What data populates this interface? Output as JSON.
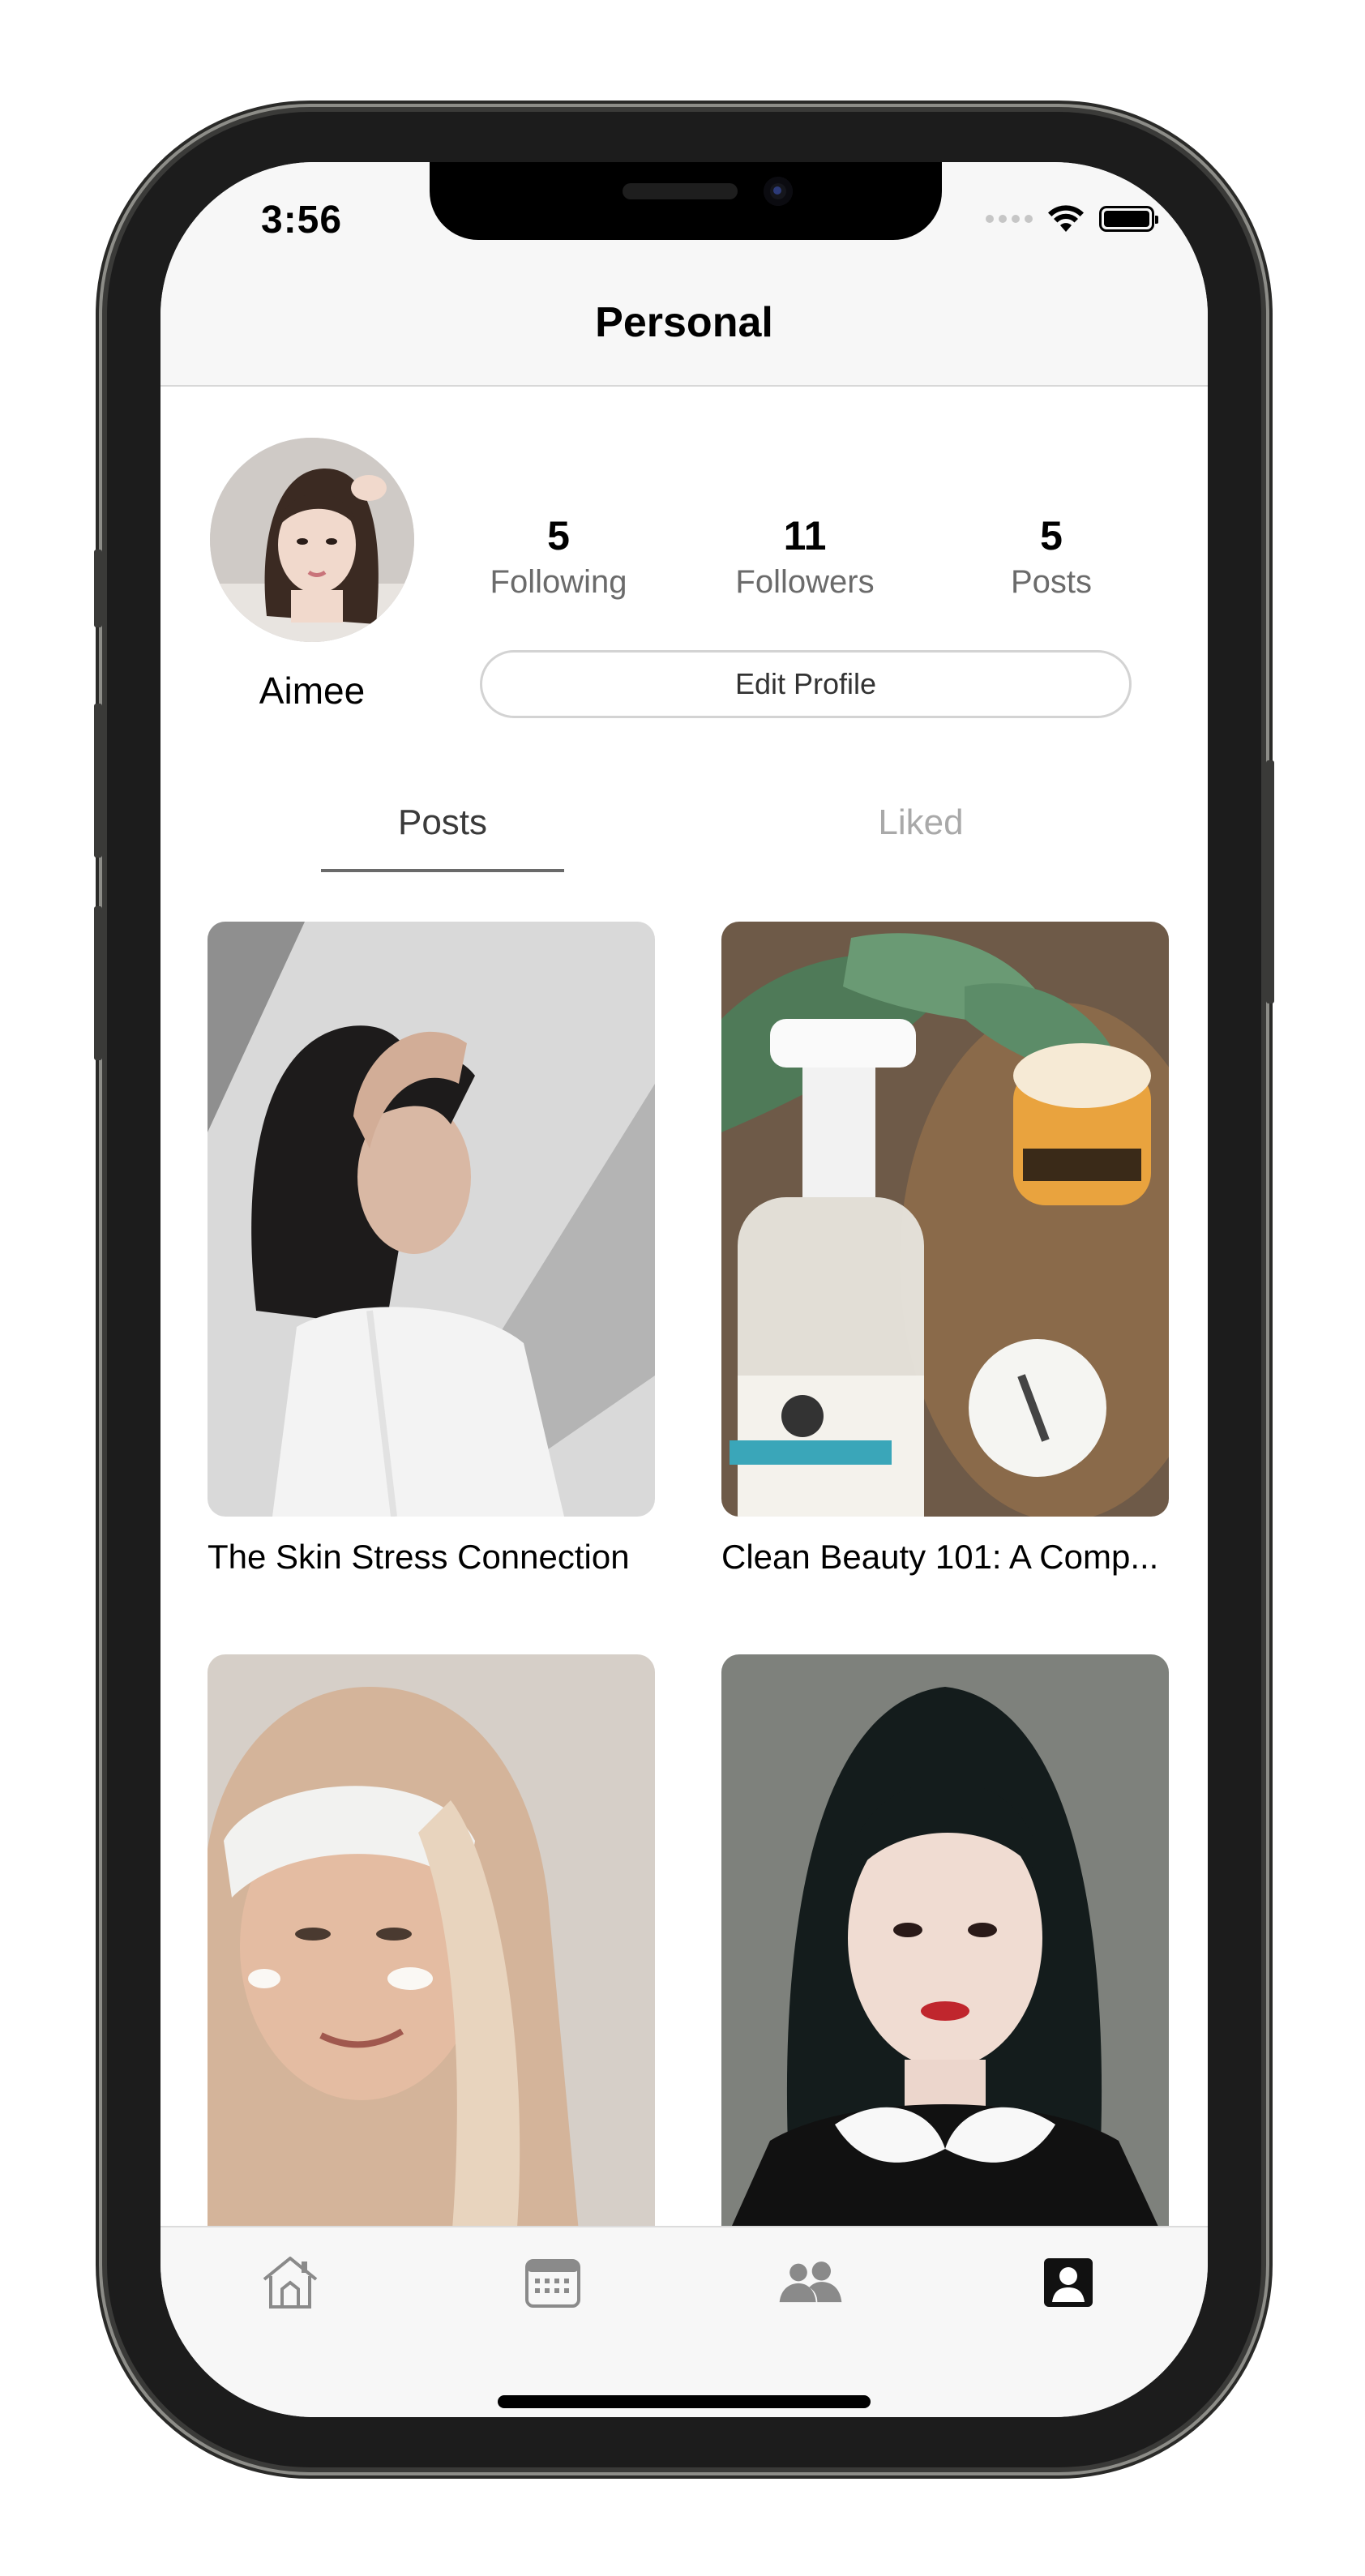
{
  "status_bar": {
    "time": "3:56"
  },
  "nav": {
    "title": "Personal"
  },
  "profile": {
    "name": "Aimee",
    "stats": [
      {
        "value": "5",
        "label": "Following"
      },
      {
        "value": "11",
        "label": "Followers"
      },
      {
        "value": "5",
        "label": "Posts"
      }
    ],
    "edit_button_label": "Edit Profile"
  },
  "tabs": [
    {
      "label": "Posts",
      "active": true
    },
    {
      "label": "Liked",
      "active": false
    }
  ],
  "posts": [
    {
      "title": "The Skin Stress Connection",
      "image": "woman-hand-on-forehead-photo"
    },
    {
      "title": "Clean Beauty 101: A Comp...",
      "image": "skincare-products-photo"
    },
    {
      "title": "",
      "image": "woman-headband-face-cream-photo"
    },
    {
      "title": "",
      "image": "woman-black-dress-portrait-photo"
    }
  ],
  "tabbar": [
    {
      "icon": "home-icon",
      "active": false
    },
    {
      "icon": "calendar-icon",
      "active": false
    },
    {
      "icon": "people-icon",
      "active": false
    },
    {
      "icon": "profile-icon",
      "active": true
    }
  ],
  "colors": {
    "accent_dark": "#000000",
    "inactive_gray": "#8a8a8a",
    "nav_bg": "#f7f7f7"
  }
}
